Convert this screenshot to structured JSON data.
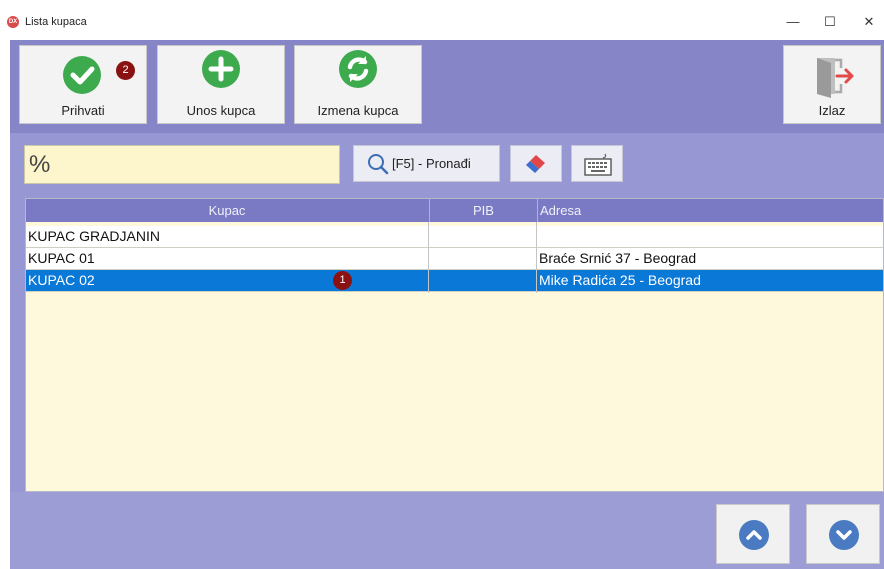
{
  "window": {
    "title": "Lista kupaca",
    "app_icon_text": "DX",
    "controls": {
      "minimize": "—",
      "maximize": "☐",
      "close": "✕"
    }
  },
  "toolbar": {
    "accept_label": "Prihvati",
    "accept_badge": "2",
    "add_label": "Unos kupca",
    "edit_label": "Izmena kupca",
    "exit_label": "Izlaz"
  },
  "search": {
    "value": "%",
    "find_label": "[F5] - Pronađi"
  },
  "grid": {
    "columns": [
      "Kupac",
      "PIB",
      "Adresa"
    ],
    "rows": [
      {
        "kupac": "KUPAC GRADJANIN",
        "pib": "",
        "adresa": ""
      },
      {
        "kupac": "KUPAC 01",
        "pib": "",
        "adresa": "Braće Srnić 37 - Beograd"
      },
      {
        "kupac": "KUPAC 02",
        "pib": "",
        "adresa": "Mike Radića 25 - Beograd"
      }
    ],
    "selected_badge": "1"
  },
  "colors": {
    "toolbar_bg": "#8585c8",
    "selection": "#0a78d7",
    "grid_bg": "#fef8dc",
    "badge": "#8b1212",
    "green": "#3daa4d",
    "nav_blue": "#4a7bc2"
  },
  "icons": [
    "check-icon",
    "plus-icon",
    "refresh-icon",
    "exit-door-icon",
    "search-icon",
    "eraser-icon",
    "keyboard-icon",
    "chevron-up-icon",
    "chevron-down-icon"
  ]
}
